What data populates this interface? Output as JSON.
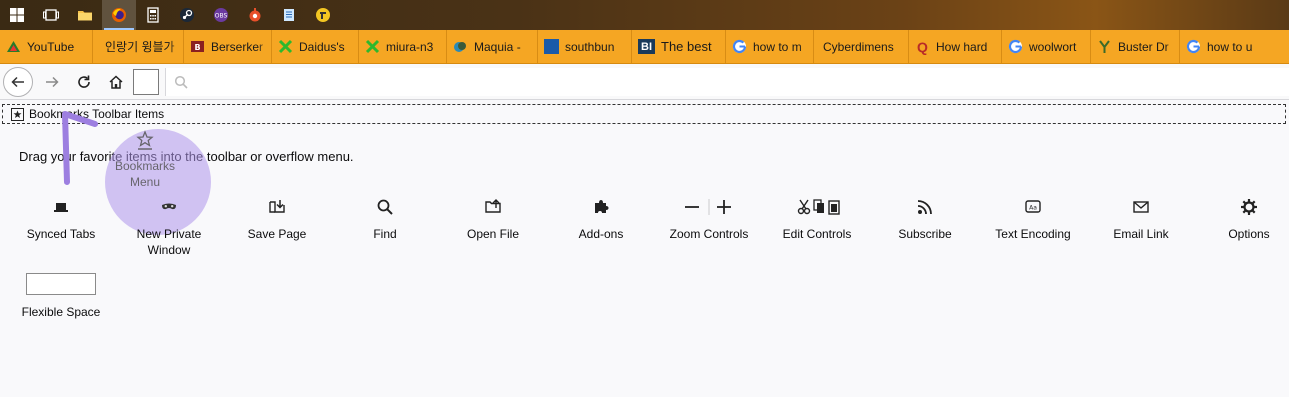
{
  "taskbar": {
    "icons": [
      "windows-start-icon",
      "task-view-icon",
      "file-explorer-icon",
      "firefox-icon",
      "calculator-icon",
      "steam-icon",
      "app-icon",
      "app-icon",
      "notepad-icon",
      "app-icon"
    ]
  },
  "tabs": [
    {
      "label": "YouTube",
      "fav": "youtube"
    },
    {
      "label": "인랑기 윙블가",
      "fav": "text"
    },
    {
      "label": "Berserker",
      "fav": "berserker"
    },
    {
      "label": "Daidus's",
      "fav": "green"
    },
    {
      "label": "miura-n3",
      "fav": "green"
    },
    {
      "label": "Maquia -",
      "fav": "maquia"
    },
    {
      "label": "southbun",
      "fav": "blue"
    },
    {
      "label": "The best",
      "fav": "bi"
    },
    {
      "label": "how to m",
      "fav": "google"
    },
    {
      "label": "Cyberdimens",
      "fav": "text"
    },
    {
      "label": "How hard",
      "fav": "quora"
    },
    {
      "label": "woolwort",
      "fav": "google"
    },
    {
      "label": "Buster Dr",
      "fav": "buster"
    },
    {
      "label": "how to u",
      "fav": "google"
    }
  ],
  "bookmarks_toolbar": {
    "label": "Bookmarks Toolbar Items"
  },
  "palette": {
    "hint": "Drag your favorite items into the toolbar or overflow menu.",
    "bookmarks_menu": {
      "line1": "Bookmarks",
      "line2": "Menu"
    },
    "items": [
      {
        "label": "Synced Tabs"
      },
      {
        "label1": "New Private",
        "label2": "Window"
      },
      {
        "label": "Save Page"
      },
      {
        "label": "Find"
      },
      {
        "label": "Open File"
      },
      {
        "label": "Add-ons"
      },
      {
        "label": "Zoom Controls"
      },
      {
        "label": "Edit Controls"
      },
      {
        "label": "Subscribe"
      },
      {
        "label": "Text Encoding"
      },
      {
        "label": "Email Link"
      },
      {
        "label": "Options"
      }
    ],
    "flexible_space": "Flexible Space"
  },
  "colors": {
    "tabstrip": "#f5a623",
    "annotation": "#9d7fe0"
  }
}
